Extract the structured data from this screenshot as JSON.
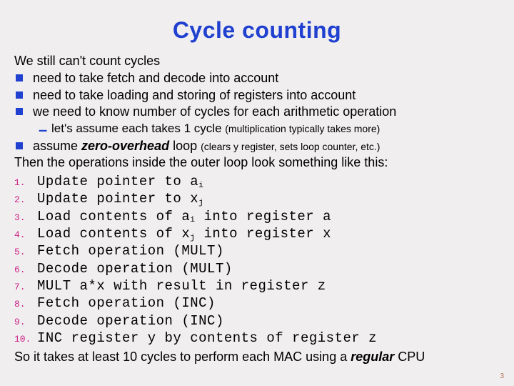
{
  "title": "Cycle counting",
  "intro": "We still can't count cycles",
  "bullets": [
    {
      "text": "need to take fetch and decode into account"
    },
    {
      "text": "need to take loading and storing of registers into account"
    },
    {
      "text": "we need to know number of cycles for each arithmetic operation",
      "sub": {
        "text": "let's assume each takes 1 cycle ",
        "extra": "(multiplication typically takes more)"
      }
    },
    {
      "prefix": "assume ",
      "emph": "zero-overhead",
      "suffix": " loop ",
      "extra": "(clears y register, sets loop counter, etc.)"
    }
  ],
  "transition": "Then the operations inside the outer loop look something like this:",
  "ops": [
    {
      "n": "1.",
      "pre": "Update pointer to a",
      "sub": "i",
      "post": ""
    },
    {
      "n": "2.",
      "pre": "Update pointer to x",
      "sub": "j",
      "post": ""
    },
    {
      "n": "3.",
      "pre": "Load contents of a",
      "sub": "i",
      "post": " into register a"
    },
    {
      "n": "4.",
      "pre": "Load contents of x",
      "sub": "j",
      "post": " into register x"
    },
    {
      "n": "5.",
      "pre": "Fetch operation (MULT)",
      "sub": "",
      "post": ""
    },
    {
      "n": "6.",
      "pre": "Decode operation (MULT)",
      "sub": "",
      "post": ""
    },
    {
      "n": "7.",
      "pre": "MULT a*x with result in register z",
      "sub": "",
      "post": ""
    },
    {
      "n": "8.",
      "pre": "Fetch operation (INC)",
      "sub": "",
      "post": ""
    },
    {
      "n": "9.",
      "pre": "Decode operation (INC)",
      "sub": "",
      "post": ""
    },
    {
      "n": "10.",
      "pre": "INC register y by contents of register z",
      "sub": "",
      "post": ""
    }
  ],
  "concl_pre": "So it takes at least 10 cycles to perform each MAC using a ",
  "concl_emph": "regular",
  "concl_post": " CPU",
  "page": "3"
}
